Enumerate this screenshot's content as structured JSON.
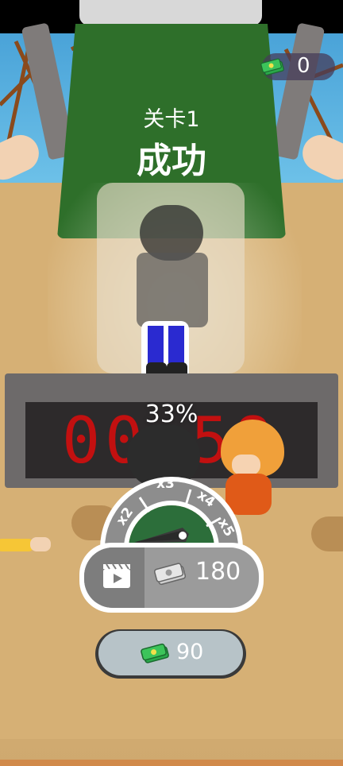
{
  "hud": {
    "coin_count": "0",
    "coin_icon": "cash-stack-icon"
  },
  "result": {
    "level_label": "关卡1",
    "status_label": "成功"
  },
  "timer": {
    "digits": "00 58",
    "color": "#c21010"
  },
  "progress": {
    "percent_label": "33%",
    "value": 0.33
  },
  "multiplier": {
    "options": [
      "x2",
      "x3",
      "x4",
      "x5"
    ]
  },
  "reward": {
    "ad_icon": "video-clapper-icon",
    "amount": "180"
  },
  "claim": {
    "amount": "90",
    "icon": "cash-stack-icon"
  }
}
